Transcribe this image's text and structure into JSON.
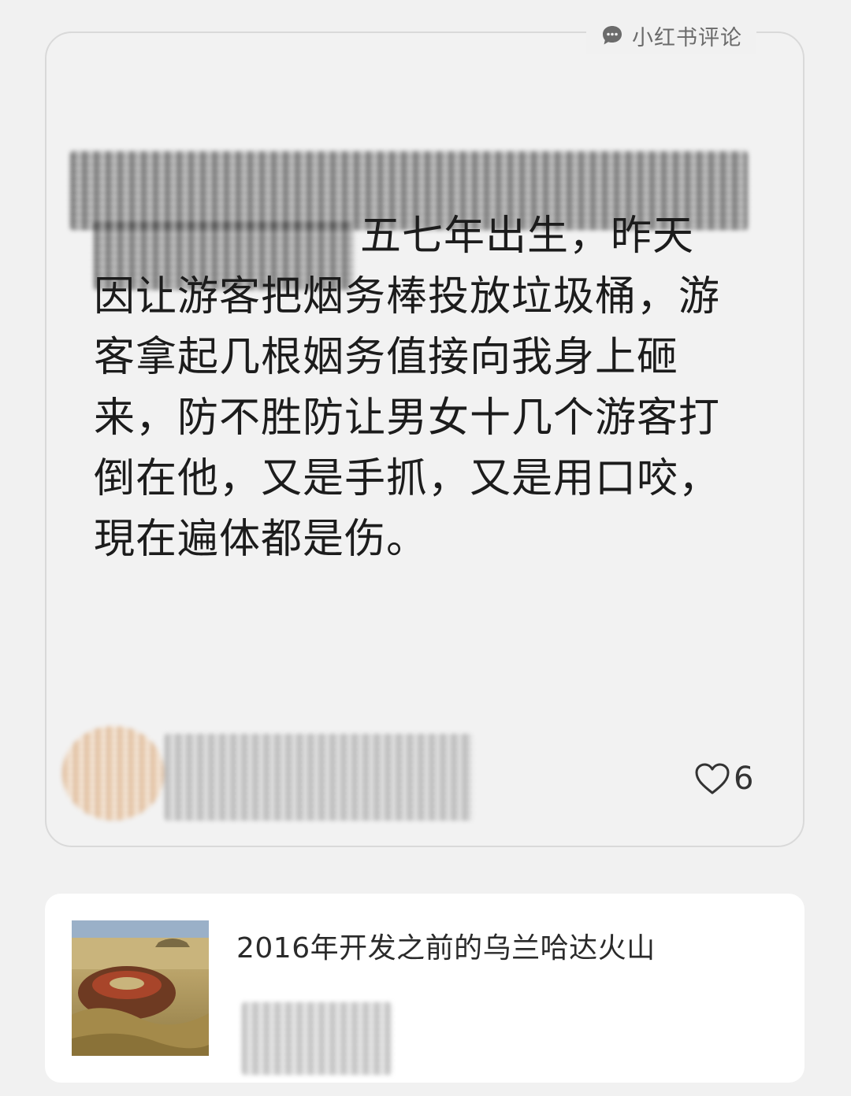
{
  "comment": {
    "source_label": "小红书评论",
    "body": "五七年出生，昨天因让游客把烟务棒投放垃圾桶，游客拿起几根姻务值接向我身上砸来，防不胜防让男女十几个游客打倒在他，又是手抓，又是用口咬，現在遍体都是伤。",
    "like_count": "6"
  },
  "note": {
    "title": "2016年开发之前的乌兰哈达火山"
  },
  "icons": {
    "source": "chat-bubble-icon",
    "like": "heart-icon"
  }
}
